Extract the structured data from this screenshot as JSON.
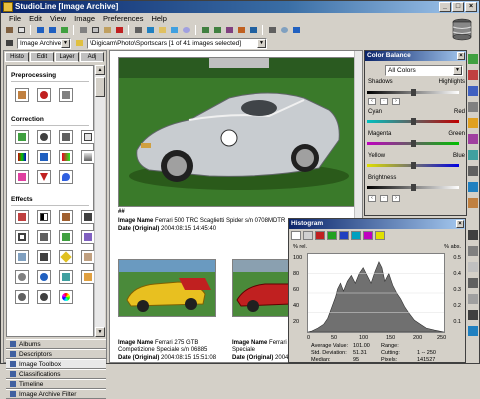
{
  "window": {
    "title": "StudioLine [Image Archive]"
  },
  "menu": [
    "File",
    "Edit",
    "View",
    "Image",
    "Preferences",
    "Help"
  ],
  "address": {
    "archive_label": "Image Archive",
    "path": "\\Digicam\\Photo\\Sportscars [1 of 41 images selected]"
  },
  "leftpanel": {
    "tabs": [
      "Histo",
      "Edit",
      "Layer",
      "Adj"
    ],
    "sections": {
      "preprocessing": "Preprocessing",
      "correction": "Correction",
      "effects": "Effects"
    },
    "effect_label": "Black White"
  },
  "nav": {
    "items": [
      "Albums",
      "Descriptors",
      "Image Toolbox",
      "Classifications",
      "Timeline",
      "Image Archive Filter"
    ]
  },
  "main": {
    "flag_big": "##",
    "image1": {
      "name_label": "Image Name",
      "name": "Ferrari 500 TRC Scaglietti Spider s/n 0708MDTR",
      "date_label": "Date (Original)",
      "date": "2004:08:15 14:45:40"
    },
    "image2": {
      "name_label": "Image Name",
      "name": "Ferrari 275 GTB",
      "name2": "Competizione Speciale s/n 06885",
      "date_label": "Date (Original)",
      "date": "2004:08:15 15:51:08"
    },
    "image3": {
      "name_label": "Image Name",
      "name": "Ferrari",
      "name2": "Speciale",
      "date_label": "Date (Original)",
      "date": "2004:08:15"
    }
  },
  "color_balance": {
    "title": "Color Balance",
    "channel": "All Colors",
    "rows": [
      {
        "left": "Shadows",
        "right": "Highlights"
      },
      {
        "left": "Cyan",
        "right": "Red"
      },
      {
        "left": "Magenta",
        "right": "Green"
      },
      {
        "left": "Yellow",
        "right": "Blue"
      },
      {
        "left": "Brightness",
        "right": ""
      }
    ]
  },
  "histogram": {
    "title": "Histogram",
    "y_left": "% rel.",
    "y_right": "% abs.",
    "left_ticks": [
      "100",
      "80",
      "60",
      "40",
      "20"
    ],
    "right_ticks": [
      "0.5",
      "0.4",
      "0.3",
      "0.2",
      "0.1"
    ],
    "x_ticks": [
      "0",
      "50",
      "100",
      "150",
      "200",
      "250"
    ],
    "stats": {
      "average_label": "Average Value:",
      "average": "101.00",
      "std_label": "Std. Deviation:",
      "std": "51.31",
      "median_label": "Median:",
      "median": "95",
      "range_label": "Range:",
      "range": "",
      "cutting_label": "Cutting:",
      "cutting": "1 -- 250",
      "pixels_label": "Pixels:",
      "pixels": "141527"
    }
  }
}
